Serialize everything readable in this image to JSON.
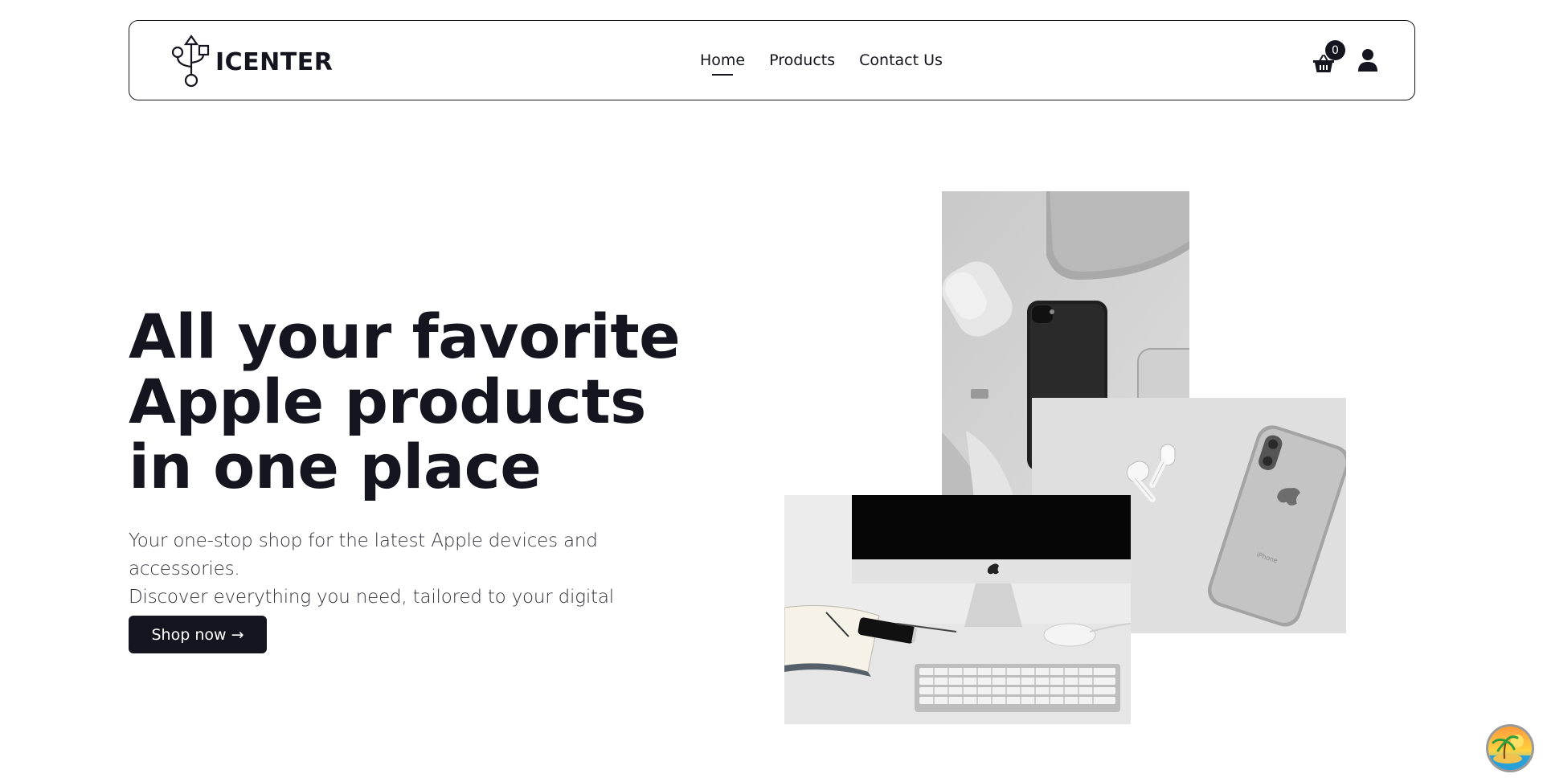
{
  "navbar": {
    "logo_text": "ICENTER",
    "links": [
      {
        "label": "Home",
        "active": true
      },
      {
        "label": "Products",
        "active": false
      },
      {
        "label": "Contact Us",
        "active": false
      }
    ],
    "cart_count": "0",
    "icons": [
      "usb-logo-icon",
      "shopping-basket-icon",
      "user-icon"
    ]
  },
  "hero": {
    "title": "All your favorite Apple products in one place",
    "subtitle_line1": "Your one-stop shop for the latest Apple devices and accessories.",
    "subtitle_line2": "Discover everything you need, tailored to your digital lifestyle.",
    "cta_label": "Shop now →"
  },
  "collage": {
    "images": [
      {
        "name": "iphone-airpods-macbook-photo"
      },
      {
        "name": "iphone-x-airpods-photo"
      },
      {
        "name": "imac-keyboard-desk-photo"
      }
    ]
  },
  "widget": {
    "icon": "island-sunset-icon"
  },
  "colors": {
    "primary": "#15151f",
    "background": "#ffffff",
    "text_muted": "#33333d"
  }
}
